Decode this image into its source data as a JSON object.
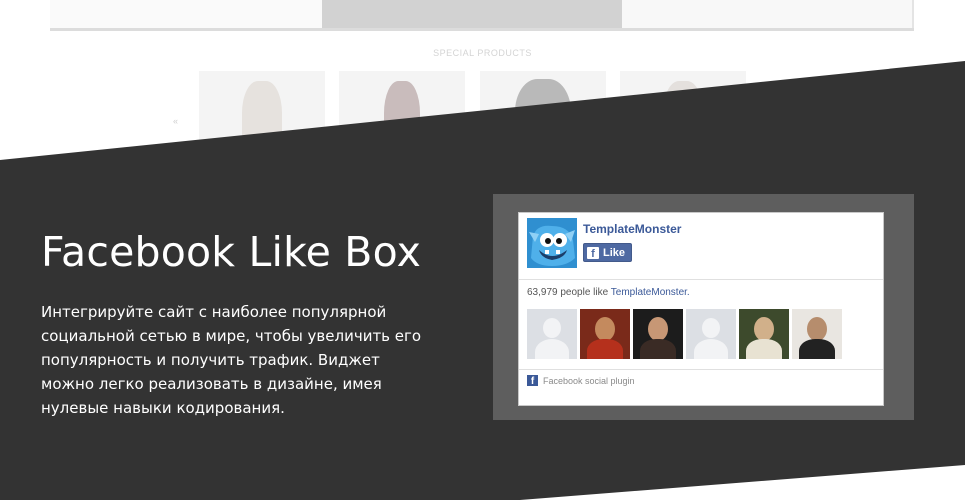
{
  "top_section": {
    "special_products_title": "SPECIAL PRODUCTS",
    "prev_arrow": "«"
  },
  "feature": {
    "heading": "Facebook Like Box",
    "description": "Интегрируйте сайт с наиболее популярной социальной сетью в мире, чтобы увеличить его популярность и получить трафик. Виджет можно легко реализовать в дизайне, имея нулевые навыки кодирования."
  },
  "facebook_widget": {
    "page_name": "TemplateMonster",
    "like_button_label": "Like",
    "like_button_icon": "f",
    "count_text": "63,979 people like ",
    "count_link": "TemplateMonster.",
    "footer_icon": "f",
    "footer_text": "Facebook social plugin",
    "fans": [
      {
        "type": "default-avatar-icon"
      },
      {
        "type": "profile-photo"
      },
      {
        "type": "profile-photo"
      },
      {
        "type": "default-avatar-icon"
      },
      {
        "type": "profile-photo"
      },
      {
        "type": "profile-photo"
      }
    ]
  },
  "colors": {
    "dark_band": "#333333",
    "widget_frame": "#5e5e5e",
    "facebook_blue": "#3b5998",
    "like_button": "#4e69a2",
    "text_light": "#ffffff"
  }
}
